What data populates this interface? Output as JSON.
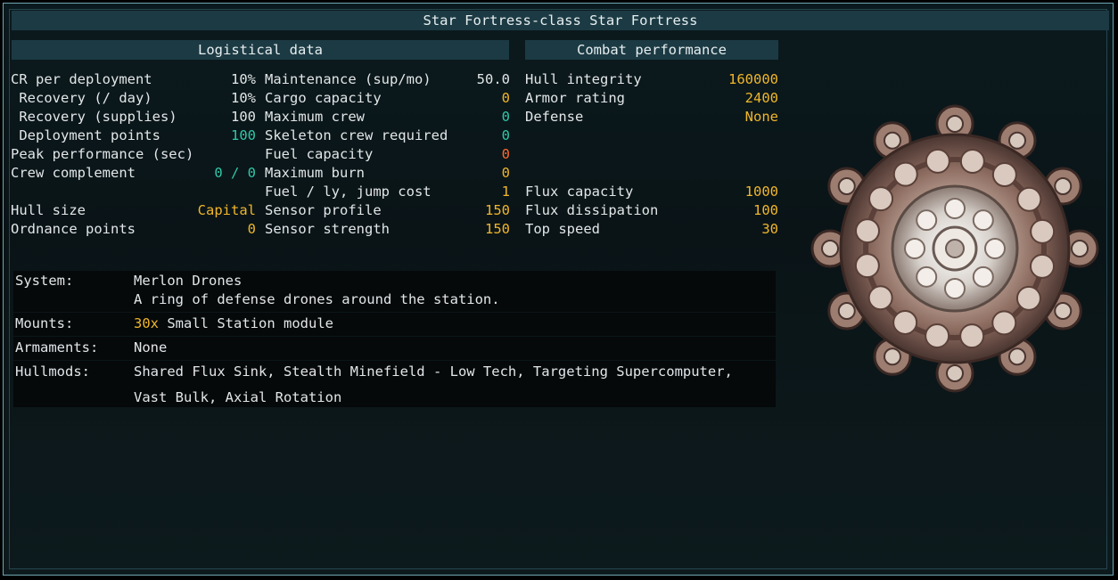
{
  "title": "Star Fortress-class Star Fortress",
  "logistics": {
    "heading": "Logistical data",
    "col1": [
      {
        "label": "CR per deployment",
        "value": "10%",
        "color": "white"
      },
      {
        "label": " Recovery (/ day)",
        "value": "10%",
        "color": "white"
      },
      {
        "label": " Recovery (supplies)",
        "value": "100",
        "color": "white"
      },
      {
        "label": " Deployment points",
        "value": "100",
        "color": "teal"
      },
      {
        "label": "Peak performance (sec)",
        "value": "",
        "color": "white"
      },
      {
        "label": "Crew complement",
        "value": "0 / 0",
        "color": "teal"
      },
      {
        "label": "Hull size",
        "value": "Capital",
        "color": "yellow"
      },
      {
        "label": "Ordnance points",
        "value": "0",
        "color": "yellow"
      }
    ],
    "col2": [
      {
        "label": "Maintenance (sup/mo)",
        "value": "50.0",
        "color": "white"
      },
      {
        "label": "Cargo capacity",
        "value": "0",
        "color": "yellow"
      },
      {
        "label": "Maximum crew",
        "value": "0",
        "color": "teal"
      },
      {
        "label": "Skeleton crew required",
        "value": "0",
        "color": "teal"
      },
      {
        "label": "Fuel capacity",
        "value": "0",
        "color": "orange"
      },
      {
        "label": "Maximum burn",
        "value": "0",
        "color": "yellow"
      },
      {
        "label": "Fuel / ly, jump cost",
        "value": "1",
        "color": "yellow"
      },
      {
        "label": "Sensor profile",
        "value": "150",
        "color": "yellow"
      },
      {
        "label": "Sensor strength",
        "value": "150",
        "color": "yellow"
      }
    ]
  },
  "combat": {
    "heading": "Combat performance",
    "rows": [
      {
        "label": "Hull integrity",
        "value": "160000",
        "color": "yellow"
      },
      {
        "label": "Armor rating",
        "value": "2400",
        "color": "yellow"
      },
      {
        "label": "Defense",
        "value": "None",
        "color": "yellow"
      },
      {
        "label": "Flux capacity",
        "value": "1000",
        "color": "yellow"
      },
      {
        "label": "Flux dissipation",
        "value": "100",
        "color": "yellow"
      },
      {
        "label": "Top speed",
        "value": "30",
        "color": "yellow"
      }
    ]
  },
  "details": {
    "system_label": "System:",
    "system_name": "Merlon Drones",
    "system_desc": "A ring of defense drones around the station.",
    "mounts_label": "Mounts:",
    "mounts_count": "30x",
    "mounts_type": "Small Station module",
    "armaments_label": "Armaments:",
    "armaments_value": "None",
    "hullmods_label": "Hullmods:",
    "hullmods_line1": "Shared Flux Sink, Stealth Minefield - Low Tech, Targeting Supercomputer,",
    "hullmods_line2": "Vast Bulk, Axial Rotation"
  },
  "colors": {
    "white": "#e2e6e8",
    "yellow": "#f0b62a",
    "teal": "#30c8a8",
    "orange": "#ff6a2a",
    "header": "#1c3a43"
  },
  "ship_icon": "star-fortress-sprite"
}
